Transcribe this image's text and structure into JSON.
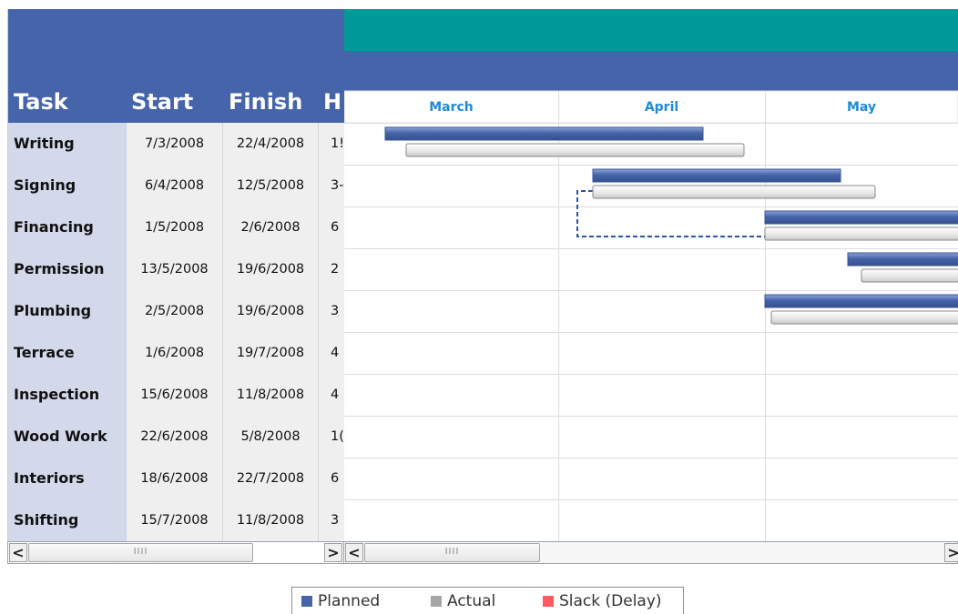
{
  "grid": {
    "columns": {
      "task": "Task",
      "start": "Start",
      "finish": "Finish",
      "h": "H"
    },
    "rows": [
      {
        "task": "Writing",
        "start": "7/3/2008",
        "finish": "22/4/2008",
        "h": "1!"
      },
      {
        "task": "Signing",
        "start": "6/4/2008",
        "finish": "12/5/2008",
        "h": "3-"
      },
      {
        "task": "Financing",
        "start": "1/5/2008",
        "finish": "2/6/2008",
        "h": "6"
      },
      {
        "task": "Permission",
        "start": "13/5/2008",
        "finish": "19/6/2008",
        "h": "2"
      },
      {
        "task": "Plumbing",
        "start": "2/5/2008",
        "finish": "19/6/2008",
        "h": "3"
      },
      {
        "task": "Terrace",
        "start": "1/6/2008",
        "finish": "19/7/2008",
        "h": "4"
      },
      {
        "task": "Inspection",
        "start": "15/6/2008",
        "finish": "11/8/2008",
        "h": "4"
      },
      {
        "task": "Wood Work",
        "start": "22/6/2008",
        "finish": "5/8/2008",
        "h": "1("
      },
      {
        "task": "Interiors",
        "start": "18/6/2008",
        "finish": "22/7/2008",
        "h": "6"
      },
      {
        "task": "Shifting",
        "start": "15/7/2008",
        "finish": "11/8/2008",
        "h": "3"
      }
    ]
  },
  "scrollbars": {
    "left_arrow": "<",
    "right_arrow": ">",
    "grip": "IIII"
  },
  "chart_data": {
    "type": "gantt",
    "months": [
      "March",
      "April",
      "May"
    ],
    "visible_window": [
      "2008-03-01",
      "2008-05-28"
    ],
    "tasks": [
      {
        "task": "Writing",
        "planned": [
          "2008-03-07",
          "2008-04-22"
        ],
        "actual": [
          "2008-03-10",
          "2008-04-28"
        ]
      },
      {
        "task": "Signing",
        "planned": [
          "2008-04-06",
          "2008-05-12"
        ],
        "actual": [
          "2008-04-06",
          "2008-05-17"
        ]
      },
      {
        "task": "Financing",
        "planned": [
          "2008-05-01",
          "2008-06-02"
        ],
        "actual": [
          "2008-05-01",
          "2008-06-02"
        ]
      },
      {
        "task": "Permission",
        "planned": [
          "2008-05-13",
          "2008-06-19"
        ],
        "actual": [
          "2008-05-15",
          "2008-06-19"
        ]
      },
      {
        "task": "Plumbing",
        "planned": [
          "2008-05-01",
          "2008-06-19"
        ],
        "actual": [
          "2008-05-02",
          "2008-06-19"
        ]
      }
    ],
    "connector": {
      "from": "Signing",
      "to": "Financing",
      "style": "dashed"
    },
    "legend": [
      {
        "label": "Planned",
        "color": "#4564a9"
      },
      {
        "label": "Actual",
        "color": "#a6a6a6"
      },
      {
        "label": "Slack (Delay)",
        "color": "#ff5a5f"
      }
    ]
  },
  "colors": {
    "header": "#4564a9",
    "header_band": "#029999",
    "month_label": "#1f8ad6",
    "grid_line": "#dcdcdc",
    "connector": "#2c55a8"
  }
}
